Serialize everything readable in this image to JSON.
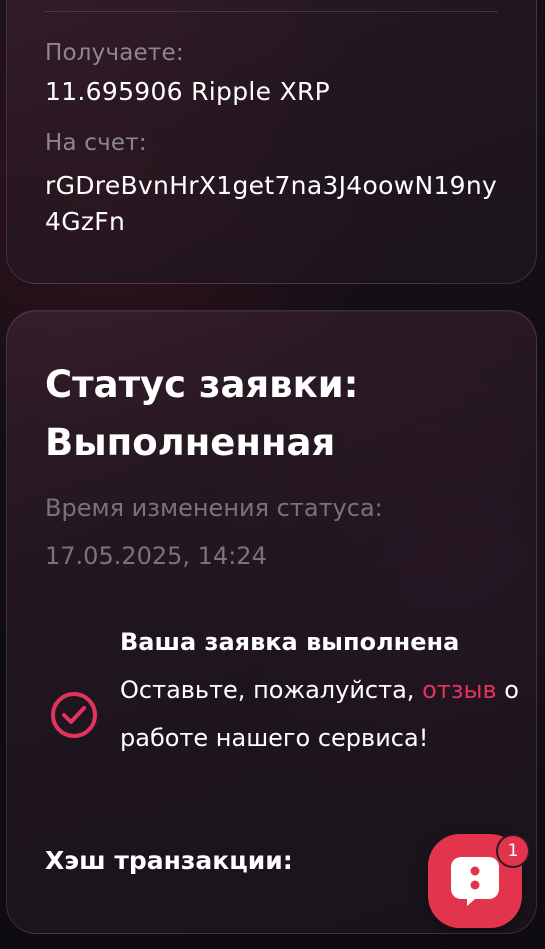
{
  "transfer": {
    "receive_label": "Получаете:",
    "receive_value": "11.695906 Ripple XRP",
    "account_label": "На счет:",
    "account_value": "rGDreBvnHrX1get7na3J4oowN19ny4GzFn"
  },
  "status": {
    "title": "Статус заявки: Выполненная",
    "time_label": "Время изменения статуса:",
    "time_value": "17.05.2025, 14:24",
    "done_title": "Ваша заявка выполнена",
    "message_before": "Оставьте, пожалуйста,",
    "review_link": "отзыв",
    "message_after": "о работе нашего сервиса!",
    "hash_label": "Хэш транзакции:"
  },
  "chat": {
    "badge_count": "1",
    "icon": "chat-bubble-icon",
    "accent": "#e3344d"
  },
  "colors": {
    "accent": "#e0345c",
    "muted_text": "#8d8790",
    "background": "#0f0c12"
  }
}
